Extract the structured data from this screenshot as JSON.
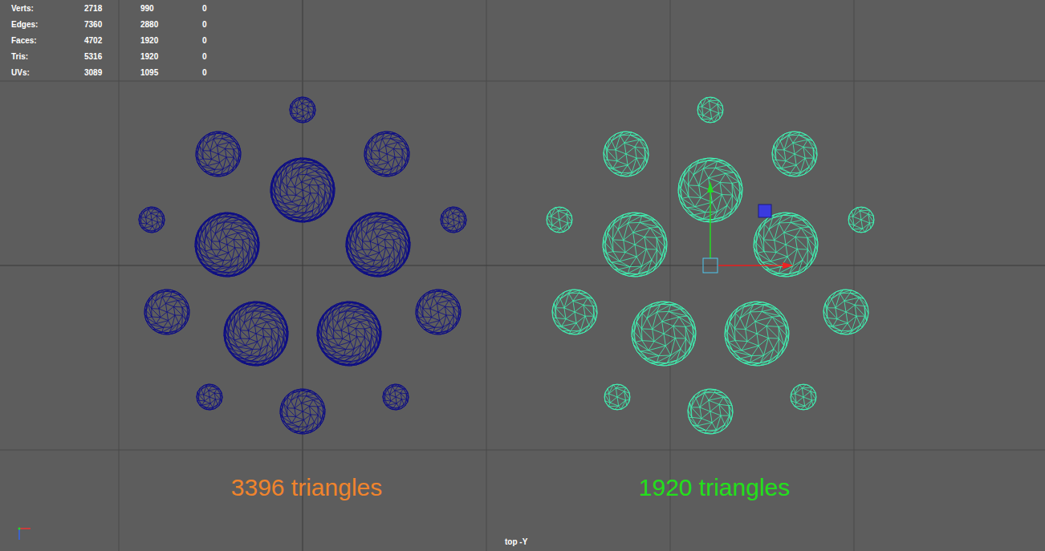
{
  "hud": {
    "rows": [
      {
        "label": "Verts:",
        "values": [
          "2718",
          "990",
          "0"
        ]
      },
      {
        "label": "Edges:",
        "values": [
          "7360",
          "2880",
          "0"
        ]
      },
      {
        "label": "Faces:",
        "values": [
          "4702",
          "1920",
          "0"
        ]
      },
      {
        "label": "Tris:",
        "values": [
          "5316",
          "1920",
          "0"
        ]
      },
      {
        "label": "UVs:",
        "values": [
          "3089",
          "1095",
          "0"
        ]
      }
    ]
  },
  "meshes": [
    {
      "caption": "3396 triangles",
      "wire_color": "#0d0d85",
      "caption_color": "#f0842c",
      "selected": false
    },
    {
      "caption": "1920 triangles",
      "wire_color": "#3ff2b3",
      "caption_color": "#22e01a",
      "selected": true
    }
  ],
  "viewport": {
    "camera": "top -Y"
  }
}
